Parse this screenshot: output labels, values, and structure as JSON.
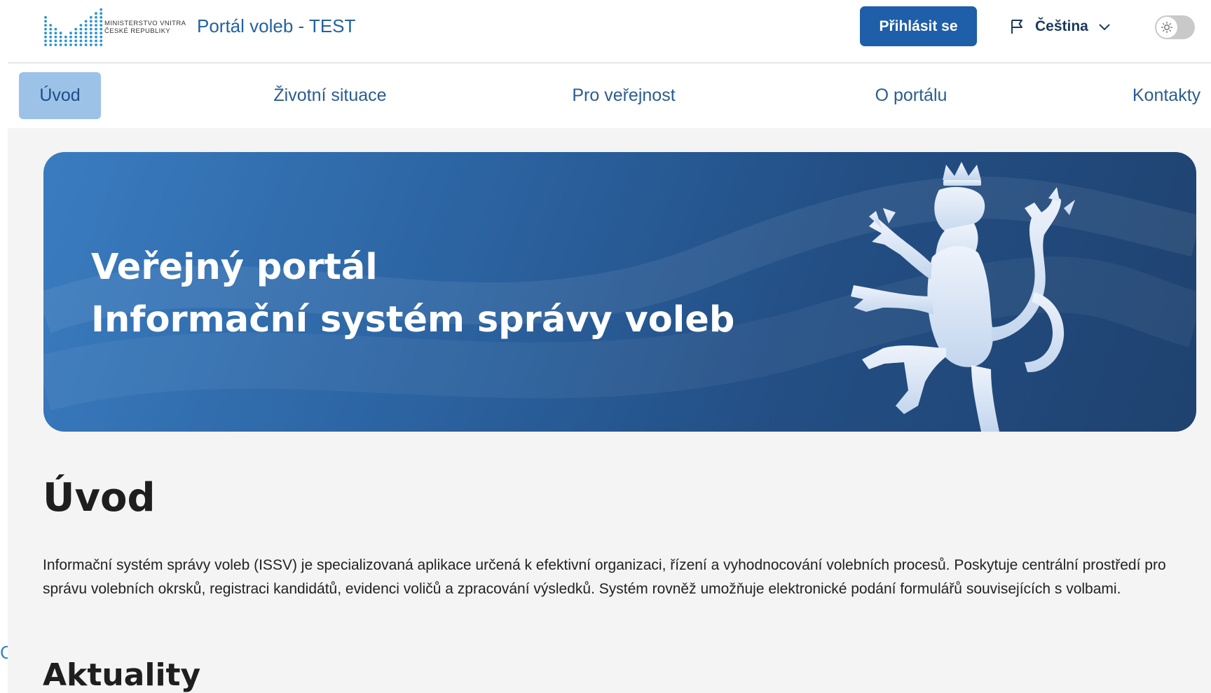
{
  "header": {
    "logo_text_line1": "MINISTERSTVO VNITRA",
    "logo_text_line2": "ČESKÉ REPUBLIKY",
    "portal_name": "Portál voleb - TEST",
    "login_label": "Přihlásit se",
    "language": "Čeština",
    "theme_icon": "sun-icon",
    "brand_color": "#1f5ea8"
  },
  "nav": {
    "items": [
      {
        "label": "Úvod",
        "active": true
      },
      {
        "label": "Životní situace",
        "active": false
      },
      {
        "label": "Pro veřejnost",
        "active": false
      },
      {
        "label": "O portálu",
        "active": false
      },
      {
        "label": "Kontakty",
        "active": false
      }
    ]
  },
  "hero": {
    "line1": "Veřejný portál",
    "line2": "Informační systém správy voleb",
    "emblem": "czech-lion-emblem"
  },
  "main": {
    "title": "Úvod",
    "intro": "Informační systém správy voleb (ISSV) je specializovaná aplikace určená k efektivní organizaci, řízení a vyhodnocování volebních procesů. Poskytuje centrální prostředí pro správu volebních okrsků, registraci kandidátů, evidenci voličů a zpracování výsledků. Systém rovněž umožňuje elektronické podání formulářů souvisejících s volbami.",
    "news_title": "Aktuality"
  }
}
